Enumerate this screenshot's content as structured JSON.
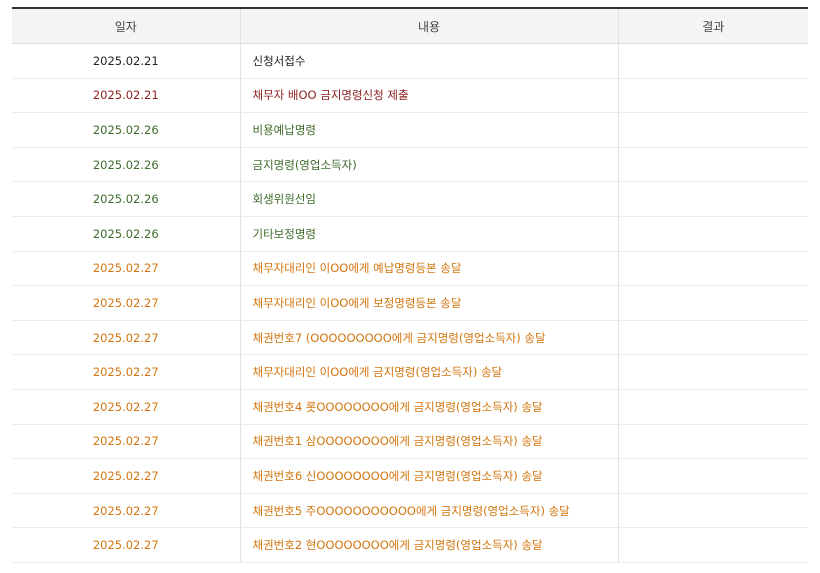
{
  "colors": {
    "black": "#222222",
    "maroon": "#8b1f1f",
    "green": "#3f6b2c",
    "orange": "#d2750e",
    "header_bg": "#f4f4f4",
    "header_top_border": "#333333"
  },
  "table": {
    "headers": [
      "일자",
      "내용",
      "결과"
    ],
    "rows": [
      {
        "date": "2025.02.21",
        "content": "신청서접수",
        "result": "",
        "color": "black"
      },
      {
        "date": "2025.02.21",
        "content": "채무자 배OO 금지명령신청 제출",
        "result": "",
        "color": "maroon"
      },
      {
        "date": "2025.02.26",
        "content": "비용예납명령",
        "result": "",
        "color": "green"
      },
      {
        "date": "2025.02.26",
        "content": "금지명령(영업소득자)",
        "result": "",
        "color": "green"
      },
      {
        "date": "2025.02.26",
        "content": "회생위원선임",
        "result": "",
        "color": "green"
      },
      {
        "date": "2025.02.26",
        "content": "기타보정명령",
        "result": "",
        "color": "green"
      },
      {
        "date": "2025.02.27",
        "content": "채무자대리인 이OO에게 예납명령등본 송달",
        "result": "",
        "color": "orange"
      },
      {
        "date": "2025.02.27",
        "content": "채무자대리인 이OO에게 보정명령등본 송달",
        "result": "",
        "color": "orange"
      },
      {
        "date": "2025.02.27",
        "content": "채권번호7 (OOOOOOOOO에게 금지명령(영업소득자) 송달",
        "result": "",
        "color": "orange"
      },
      {
        "date": "2025.02.27",
        "content": "채무자대리인 이OO에게 금지명령(영업소득자) 송달",
        "result": "",
        "color": "orange"
      },
      {
        "date": "2025.02.27",
        "content": "채권번호4 롯OOOOOOOO에게 금지명령(영업소득자) 송달",
        "result": "",
        "color": "orange"
      },
      {
        "date": "2025.02.27",
        "content": "채권번호1 삼OOOOOOOO에게 금지명령(영업소득자) 송달",
        "result": "",
        "color": "orange"
      },
      {
        "date": "2025.02.27",
        "content": "채권번호6 신OOOOOOOO에게 금지명령(영업소득자) 송달",
        "result": "",
        "color": "orange"
      },
      {
        "date": "2025.02.27",
        "content": "채권번호5 주OOOOOOOOOOO에게 금지명령(영업소득자) 송달",
        "result": "",
        "color": "orange"
      },
      {
        "date": "2025.02.27",
        "content": "채권번호2 현OOOOOOOO에게 금지명령(영업소득자) 송달",
        "result": "",
        "color": "orange"
      }
    ]
  }
}
